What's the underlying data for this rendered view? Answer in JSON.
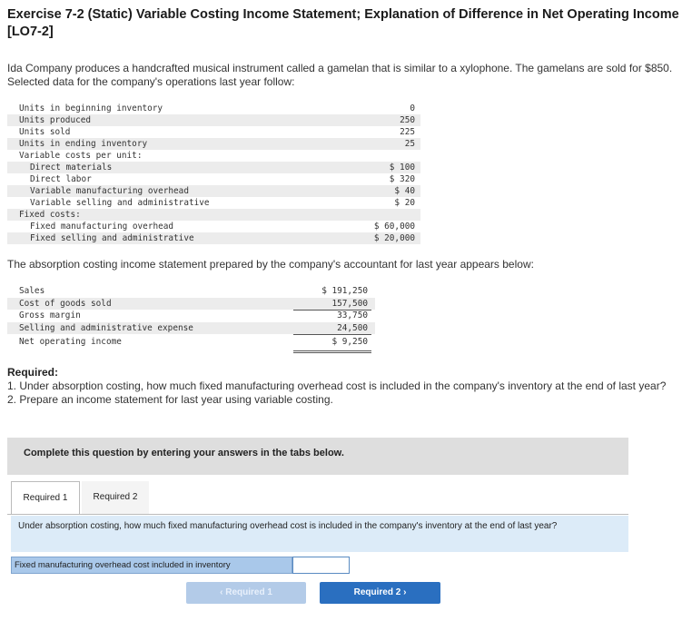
{
  "header": {
    "title": "Exercise 7-2 (Static) Variable Costing Income Statement; Explanation of Difference in Net Operating Income [LO7-2]"
  },
  "intro": "Ida Company produces a handcrafted musical instrument called a gamelan that is similar to a xylophone. The gamelans are sold for $850. Selected data for the company's operations last year follow:",
  "data_table": {
    "rows": [
      {
        "label": "Units in beginning inventory",
        "value": "0"
      },
      {
        "label": "Units produced",
        "value": "250"
      },
      {
        "label": "Units sold",
        "value": "225"
      },
      {
        "label": "Units in ending inventory",
        "value": "25"
      },
      {
        "label": "Variable costs per unit:",
        "value": ""
      },
      {
        "label": "Direct materials",
        "value": "$ 100"
      },
      {
        "label": "Direct labor",
        "value": "$ 320"
      },
      {
        "label": "Variable manufacturing overhead",
        "value": "$ 40"
      },
      {
        "label": "Variable selling and administrative",
        "value": "$ 20"
      },
      {
        "label": "Fixed costs:",
        "value": ""
      },
      {
        "label": "Fixed manufacturing overhead",
        "value": "$ 60,000"
      },
      {
        "label": "Fixed selling and administrative",
        "value": "$ 20,000"
      }
    ]
  },
  "absorption_intro": "The absorption costing income statement prepared by the company's accountant for last year appears below:",
  "income_statement": {
    "rows": [
      {
        "label": "Sales",
        "value": "$ 191,250"
      },
      {
        "label": "Cost of goods sold",
        "value": "157,500"
      },
      {
        "label": "Gross margin",
        "value": "33,750"
      },
      {
        "label": "Selling and administrative expense",
        "value": "24,500"
      },
      {
        "label": "Net operating income",
        "value": "$ 9,250"
      }
    ]
  },
  "required": {
    "heading": "Required:",
    "item1": "1. Under absorption costing, how much fixed manufacturing overhead cost is included in the company's inventory at the end of last year?",
    "item2": "2. Prepare an income statement for last year using variable costing."
  },
  "instructions": "Complete this question by entering your answers in the tabs below.",
  "tabs": [
    {
      "label": "Required 1",
      "active": true
    },
    {
      "label": "Required 2",
      "active": false
    }
  ],
  "question": "Under absorption costing, how much fixed manufacturing overhead cost is included in the company's inventory at the end of last year?",
  "answer": {
    "label": "Fixed manufacturing overhead cost included in inventory",
    "value": ""
  },
  "nav": {
    "prev_label": "Required 1",
    "next_label": "Required 2",
    "prev_chevron": "‹",
    "next_chevron": "›"
  },
  "colors": {
    "accent": "#2a6fc0",
    "question_bg": "#dcebf8",
    "answer_label_bg": "#a9c8ea"
  }
}
